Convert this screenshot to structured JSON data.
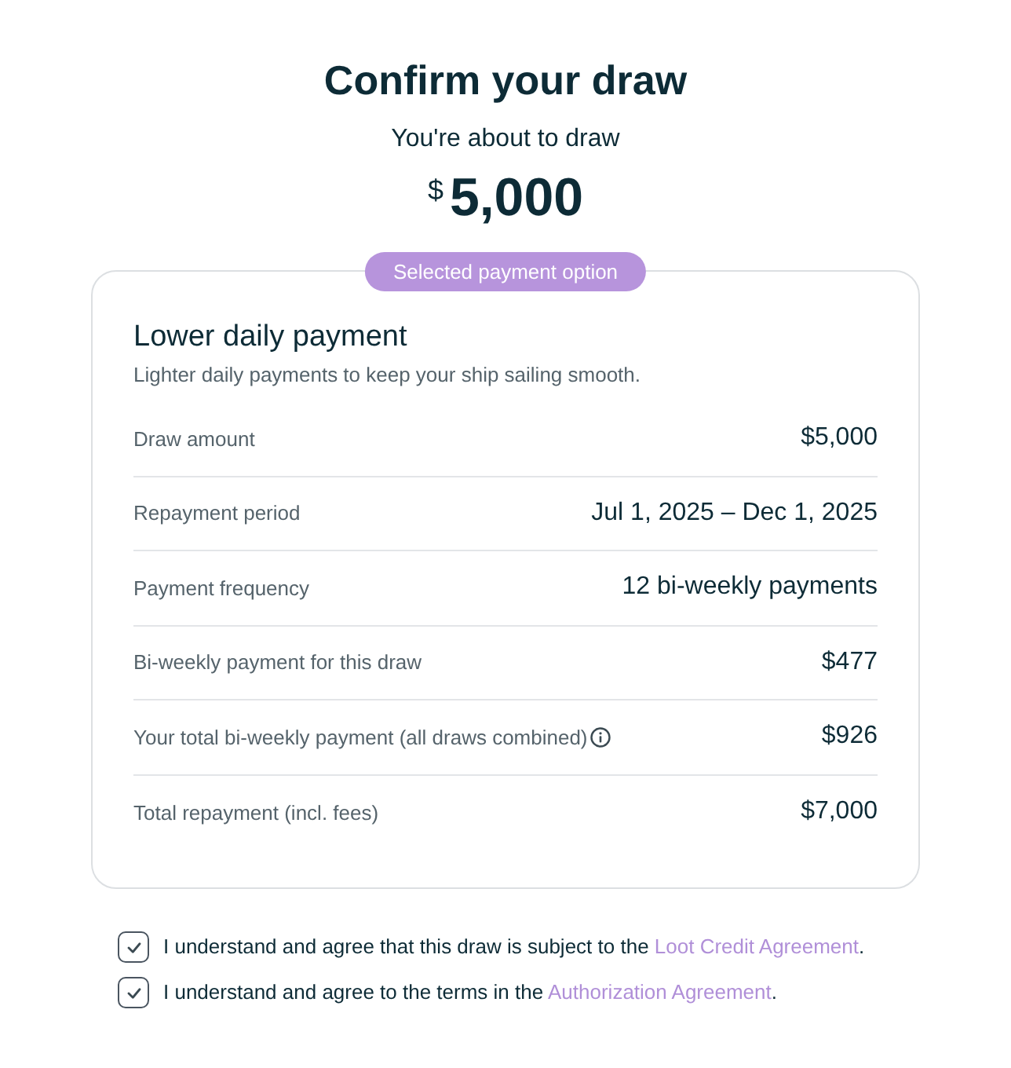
{
  "header": {
    "title": "Confirm your draw",
    "subtitle": "You're about to draw",
    "currency": "$",
    "amount": "5,000"
  },
  "option": {
    "badge": "Selected payment option",
    "title": "Lower daily payment",
    "description": "Lighter daily payments to keep your ship sailing smooth.",
    "rows": [
      {
        "label": "Draw amount",
        "value": "$5,000",
        "info": false
      },
      {
        "label": "Repayment period",
        "value": "Jul 1, 2025 – Dec 1, 2025",
        "info": false
      },
      {
        "label": "Payment frequency",
        "value": "12 bi-weekly payments",
        "info": false
      },
      {
        "label": "Bi-weekly payment for this draw",
        "value": "$477",
        "info": false
      },
      {
        "label": "Your total bi-weekly payment (all draws combined)",
        "value": "$926",
        "info": true
      },
      {
        "label": "Total repayment (incl. fees)",
        "value": "$7,000",
        "info": false
      }
    ]
  },
  "agreements": [
    {
      "checked": true,
      "text": "I understand and agree that this draw is subject to the",
      "link": "Loot Credit Agreement",
      "end": "."
    },
    {
      "checked": true,
      "text": "I understand and agree to the terms in the",
      "link": "Authorization Agreement",
      "end": "."
    }
  ]
}
